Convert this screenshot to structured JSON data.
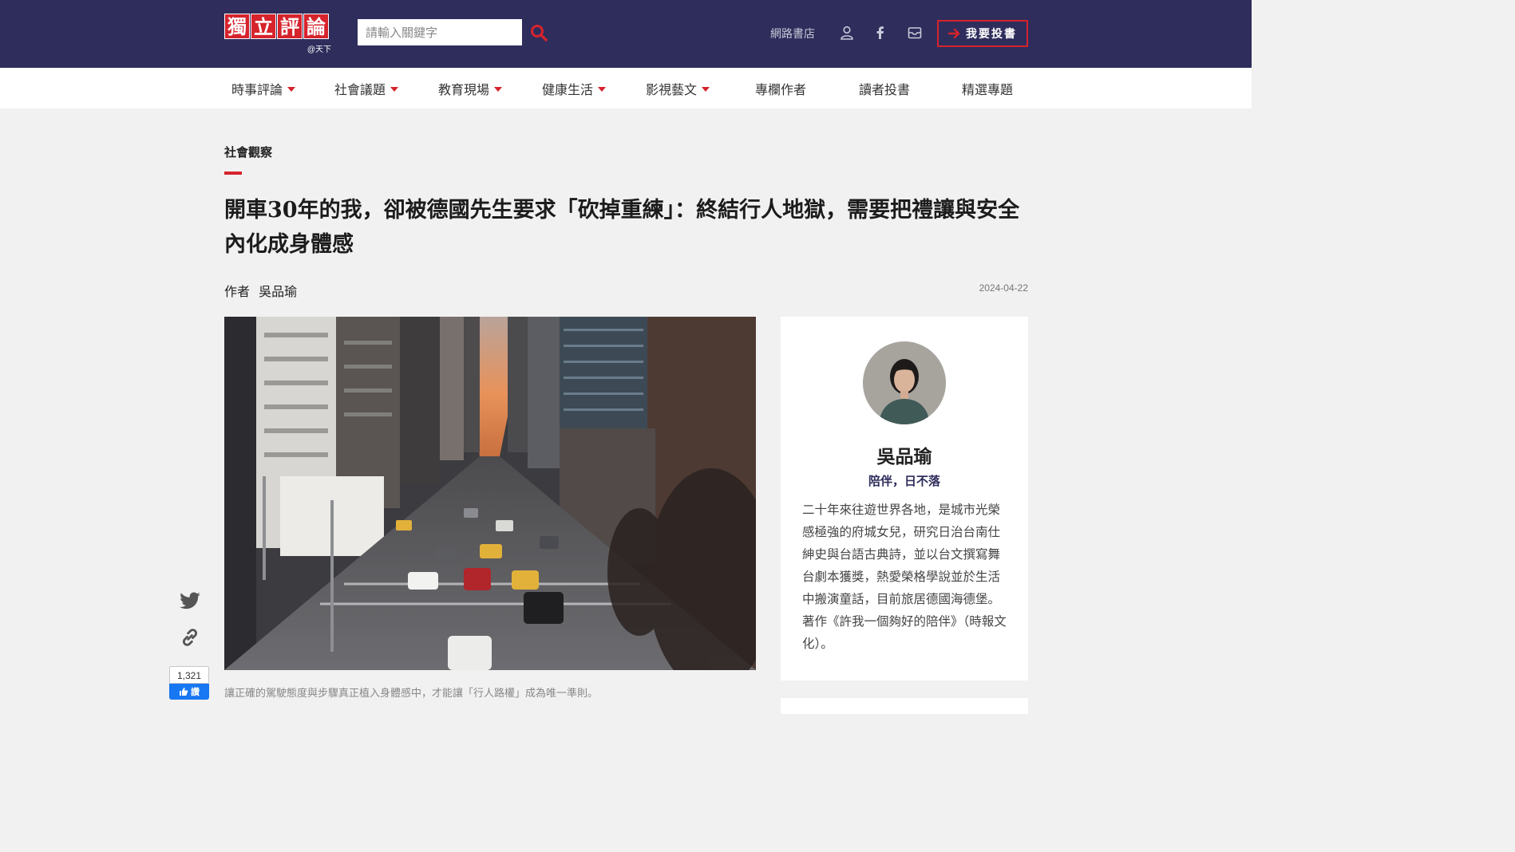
{
  "header": {
    "logo_chars": [
      "獨",
      "立",
      "評",
      "論"
    ],
    "logo_sub": "@天下",
    "search_placeholder": "請輸入關鍵字",
    "bookstore_link": "網路書店",
    "submit_label": "我要投書",
    "icons": [
      "search-icon",
      "user-icon",
      "facebook-icon",
      "mail-icon",
      "arrow-right-icon"
    ]
  },
  "nav": {
    "items": [
      {
        "label": "時事評論",
        "dropdown": true
      },
      {
        "label": "社會議題",
        "dropdown": true
      },
      {
        "label": "教育現場",
        "dropdown": true
      },
      {
        "label": "健康生活",
        "dropdown": true
      },
      {
        "label": "影視藝文",
        "dropdown": true
      },
      {
        "label": "專欄作者",
        "dropdown": false
      },
      {
        "label": "讀者投書",
        "dropdown": false
      },
      {
        "label": "精選專題",
        "dropdown": false
      }
    ]
  },
  "article": {
    "category": "社會觀察",
    "title": "開車30年的我，卻被德國先生要求「砍掉重練」：終結行人地獄，需要把禮讓與安全內化成身體感",
    "author_prefix": "作者",
    "author_name": "吳品瑜",
    "date": "2024-04-22",
    "caption": "讓正確的駕駛態度與步驟真正植入身體感中，才能讓「行人路權」成為唯一準則。"
  },
  "share": {
    "icons": [
      "twitter-icon",
      "link-icon",
      "facebook-like-icon"
    ],
    "like_count": "1,321",
    "like_label": "讚"
  },
  "author_card": {
    "name": "吳品瑜",
    "tagline": "陪伴，日不落",
    "bio": "二十年來往遊世界各地，是城市光榮感極強的府城女兒，研究日治台南仕紳史與台語古典詩，並以台文撰寫舞台劇本獲獎，熱愛榮格學說並於生活中搬演童話，目前旅居德國海德堡。著作《許我一個夠好的陪伴》（時報文化）。"
  },
  "colors": {
    "header_bg": "#2e2d5c",
    "accent_red": "#d6232c",
    "page_bg": "#f1f1f1",
    "facebook_blue": "#1877f2"
  }
}
